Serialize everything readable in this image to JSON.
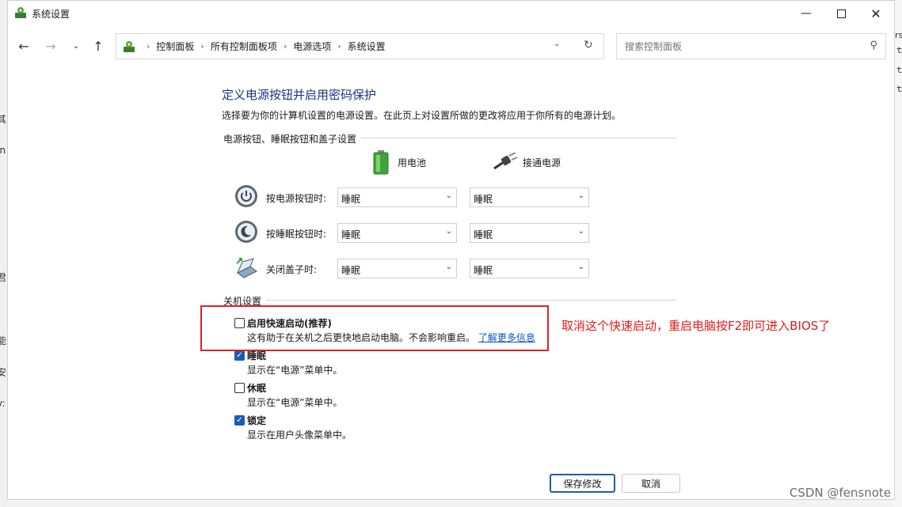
{
  "window": {
    "title": "系统设置"
  },
  "nav": {
    "crumbs": [
      "控制面板",
      "所有控制面板项",
      "电源选项",
      "系统设置"
    ]
  },
  "search": {
    "placeholder": "搜索控制面板"
  },
  "page": {
    "heading": "定义电源按钮并启用密码保护",
    "description": "选择要为你的计算机设置的电源设置。在此页上对设置所做的更改将应用于你所有的电源计划。",
    "section_power": "电源按钮、睡眠按钮和盖子设置",
    "col_battery": "用电池",
    "col_plugged": "接通电源",
    "rows": [
      {
        "label": "按电源按钮时:",
        "battery": "睡眠",
        "plugged": "睡眠"
      },
      {
        "label": "按睡眠按钮时:",
        "battery": "睡眠",
        "plugged": "睡眠"
      },
      {
        "label": "关闭盖子时:",
        "battery": "睡眠",
        "plugged": "睡眠"
      }
    ],
    "section_shutdown": "关机设置",
    "options": [
      {
        "label": "启用快速启动(推荐)",
        "desc": "这有助于在关机之后更快地启动电脑。不会影响重启。",
        "link": "了解更多信息",
        "checked": false
      },
      {
        "label": "睡眠",
        "desc": "显示在“电源”菜单中。",
        "checked": true
      },
      {
        "label": "休眠",
        "desc": "显示在“电源”菜单中。",
        "checked": false
      },
      {
        "label": "锁定",
        "desc": "显示在用户头像菜单中。",
        "checked": true
      }
    ],
    "save": "保存修改",
    "cancel": "取消"
  },
  "annotation": "取消这个快速启动，重启电脑按F2即可进入BIOS了",
  "watermark": "CSDN @fensnote",
  "background": {
    "left_glyphs": [
      "其",
      "In",
      "君",
      "能",
      "安",
      "v:"
    ],
    "right_glyphs": [
      "rs",
      "ｔ",
      "ｔ",
      "ｔ"
    ]
  },
  "colors": {
    "heading": "#1e3287",
    "accent": "#1e5bb5",
    "annotation": "#e21b1b",
    "link": "#0b55c4"
  }
}
